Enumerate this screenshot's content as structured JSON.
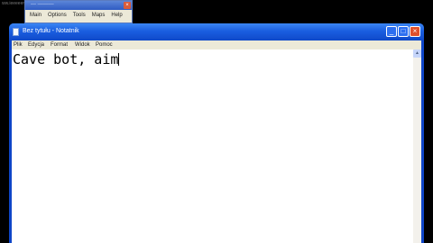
{
  "background": {
    "caption": "ww.ieeeeer.myforum.ru",
    "window": {
      "title": "— ———",
      "menu": [
        "Main",
        "Options",
        "Tools",
        "Maps",
        "Help"
      ]
    }
  },
  "window": {
    "title": "Bez tytułu - Notatnik",
    "controls": {
      "minimize": "_",
      "maximize": "□",
      "close": "×"
    },
    "menu": [
      "Plik",
      "Edycja",
      "Format",
      "Widok",
      "Pomoc"
    ]
  },
  "editor": {
    "content": "Cave bot, aim"
  },
  "scrollbar": {
    "up_arrow": "▲"
  },
  "colors": {
    "titlebar": "#1a5ee0",
    "menubar": "#ece9d8",
    "close_button": "#e0502c",
    "editor_bg": "#ffffff"
  }
}
